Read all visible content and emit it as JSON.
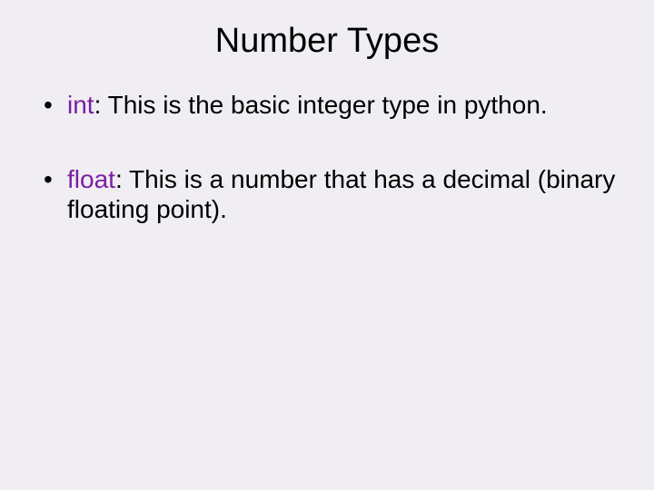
{
  "slide": {
    "title": "Number Types",
    "bullets": [
      {
        "highlight": "int",
        "highlightSuffix": ":",
        "text": " This is the basic integer type in python."
      },
      {
        "highlight": "float",
        "highlightSuffix": ":",
        "text": " This is a number that has a decimal (binary floating point)."
      }
    ]
  }
}
